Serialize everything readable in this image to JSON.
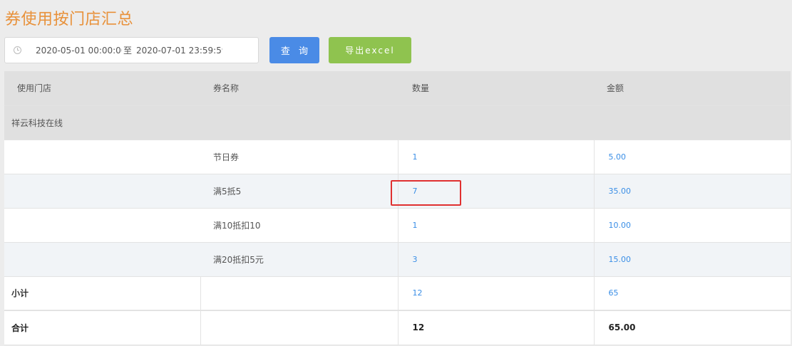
{
  "page": {
    "title": "券使用按门店汇总"
  },
  "filter": {
    "start": "2020-05-01 00:00:00",
    "separator": "至",
    "end": "2020-07-01 23:59:59",
    "query_label": "查 询",
    "export_label": "导出excel"
  },
  "table": {
    "columns": [
      "使用门店",
      "券名称",
      "数量",
      "金额"
    ],
    "store": "祥云科技在线",
    "rows": [
      {
        "name": "节日券",
        "count": "1",
        "amount": "5.00"
      },
      {
        "name": "满5抵5",
        "count": "7",
        "amount": "35.00"
      },
      {
        "name": "满10抵扣10",
        "count": "1",
        "amount": "10.00"
      },
      {
        "name": "满20抵扣5元",
        "count": "3",
        "amount": "15.00"
      }
    ],
    "subtotal": {
      "label": "小计",
      "count": "12",
      "amount": "65"
    },
    "total": {
      "label": "合计",
      "count": "12",
      "amount": "65.00"
    }
  },
  "colors": {
    "title": "#e8913a",
    "query_button": "#4a8be6",
    "export_button": "#8fc34f",
    "link_value": "#3a8ee6",
    "highlight_box": "#e03030"
  },
  "icons": {
    "date_range": "clock-icon"
  }
}
